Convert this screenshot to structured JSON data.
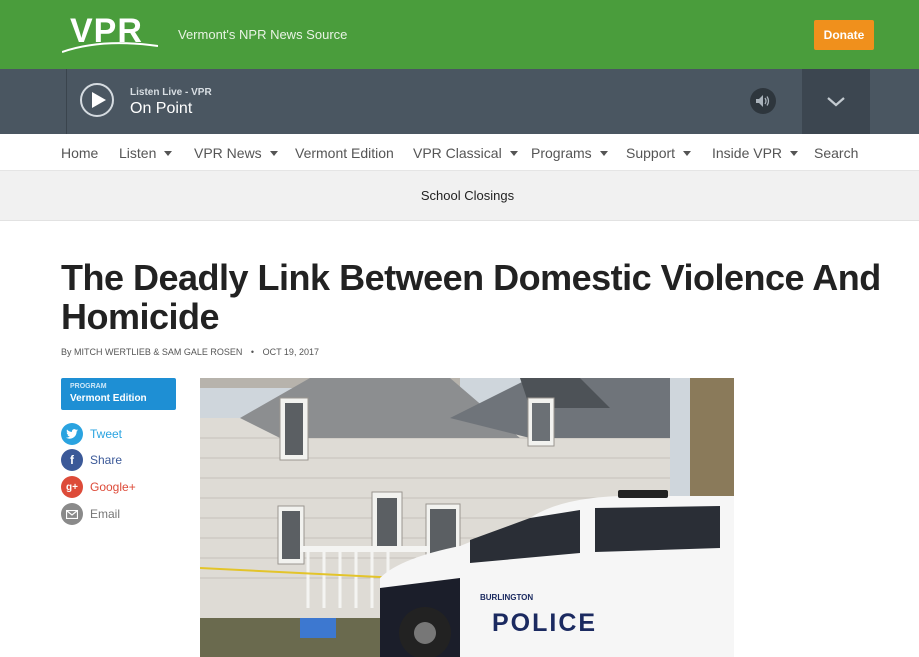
{
  "header": {
    "logo_text": "VPR",
    "tagline": "Vermont's NPR News Source",
    "donate_label": "Donate"
  },
  "player": {
    "listen_label": "Listen Live - VPR",
    "show_name": "On Point"
  },
  "nav": {
    "items": [
      {
        "label": "Home",
        "dropdown": false
      },
      {
        "label": "Listen",
        "dropdown": true
      },
      {
        "label": "VPR News",
        "dropdown": true
      },
      {
        "label": "Vermont Edition",
        "dropdown": false
      },
      {
        "label": "VPR Classical",
        "dropdown": true
      },
      {
        "label": "Programs",
        "dropdown": true
      },
      {
        "label": "Support",
        "dropdown": true
      },
      {
        "label": "Inside VPR",
        "dropdown": true
      },
      {
        "label": "Search",
        "dropdown": false
      }
    ]
  },
  "subbar": {
    "link": "School Closings"
  },
  "article": {
    "title": "The Deadly Link Between Domestic Violence And Homicide",
    "byline_prefix": "By",
    "authors": "MITCH WERTLIEB & SAM GALE ROSEN",
    "date": "OCT 19, 2017",
    "program_label": "PROGRAM",
    "program_name": "Vermont Edition",
    "photo_car_text": "BURLINGTON",
    "photo_police_text": "POLICE"
  },
  "share": [
    {
      "label": "Tweet",
      "icon": "twitter-icon",
      "color": "#2aa3e0"
    },
    {
      "label": "Share",
      "icon": "facebook-icon",
      "color": "#3b5998"
    },
    {
      "label": "Google+",
      "icon": "google-plus-icon",
      "color": "#dd4b39"
    },
    {
      "label": "Email",
      "icon": "email-icon",
      "color": "#8a8a8a"
    }
  ],
  "colors": {
    "header_green": "#4a9d3c",
    "player_bg": "#4a5661",
    "donate_orange": "#f0901c",
    "program_blue": "#1e8fd4"
  }
}
